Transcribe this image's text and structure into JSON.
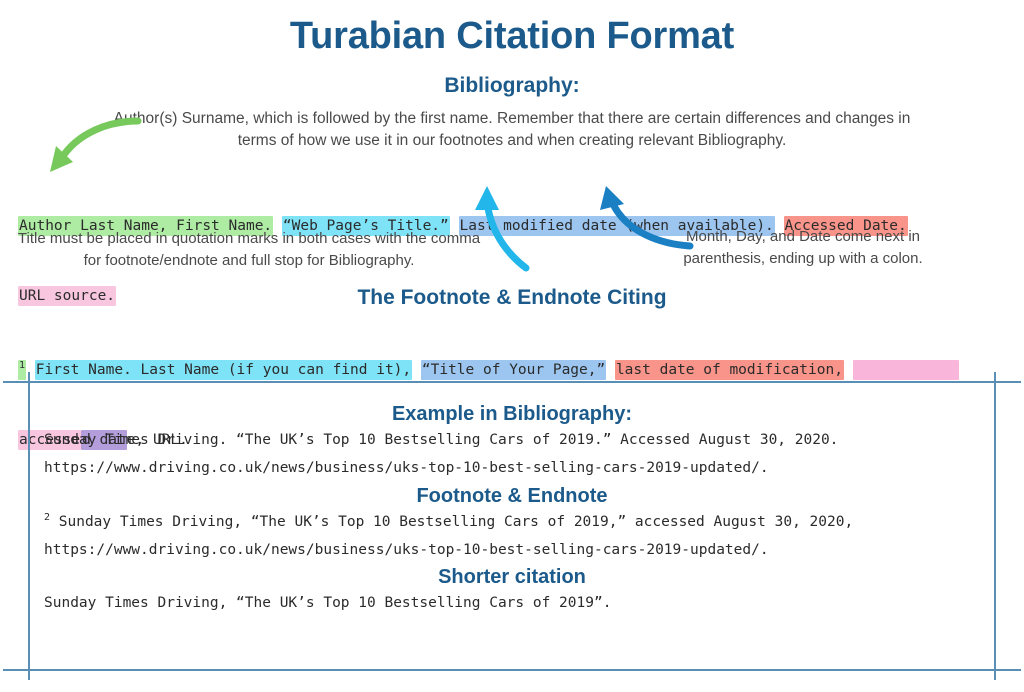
{
  "title": "Turabian Citation Format",
  "bibliography": {
    "heading": "Bibliography:",
    "description": "Author(s) Surname, which is followed by the first name. Remember that there are certain differences and changes in terms of how we use it in our footnotes and when creating relevant Bibliography.",
    "template": {
      "author": "Author Last Name, First Name.",
      "page_title": "“Web Page’s Title.”",
      "modified_date": "Last modified date (when available).",
      "accessed_date": "Accessed Date.",
      "url": "URL source."
    },
    "note_left": "Title must be placed in quotation marks in both cases with the comma for footnote/endnote and full stop for Bibliography.",
    "note_right": "Month, Day, and Date come next in parenthesis, ending up with a colon."
  },
  "footnote_section": {
    "heading": "The Footnote & Endnote Citing",
    "template": {
      "marker": "1",
      "name": "First Name. Last Name (if you can find it),",
      "page_title": "“Title of Your Page,”",
      "modified": "last date of modification,",
      "accessed_pink": "accesse",
      "accessed_purple": "d dat",
      "accessed_rest": "e, URL."
    }
  },
  "examples": {
    "bibliography": {
      "heading": "Example in Bibliography:",
      "line1": "Sunday Times Driving. “The UK’s Top 10 Bestselling Cars of 2019.” Accessed August 30, 2020.",
      "line2": "https://www.driving.co.uk/news/business/uks-top-10-best-selling-cars-2019-updated/."
    },
    "footnote": {
      "heading": "Footnote & Endnote",
      "marker": "2",
      "line1": "Sunday Times Driving, “The UK’s Top 10 Bestselling Cars of 2019,” accessed August 30, 2020,",
      "line2": "https://www.driving.co.uk/news/business/uks-top-10-best-selling-cars-2019-updated/."
    },
    "shorter": {
      "heading": "Shorter citation",
      "line1": "Sunday Times Driving, “The UK’s Top 10 Bestselling Cars of 2019”."
    }
  },
  "colors": {
    "heading_blue": "#1b5a8a",
    "box_border": "#5a8fb5",
    "highlight_green": "#aeeca4",
    "highlight_cyan": "#7fe3f7",
    "highlight_blue": "#9cc6f0",
    "highlight_red": "#f9948a",
    "highlight_pink": "#f9c6e0",
    "highlight_purple": "#b39ddb",
    "arrow_green": "#76c95a",
    "arrow_cyan": "#22b6ea",
    "arrow_blue": "#1b7fc4"
  }
}
